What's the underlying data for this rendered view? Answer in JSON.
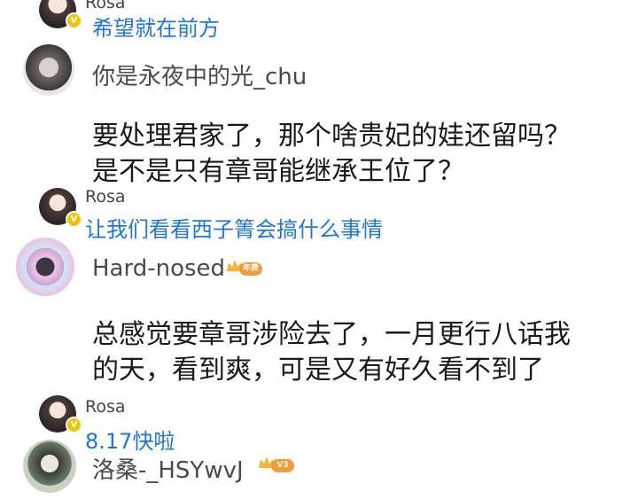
{
  "threads": [
    {
      "reply": {
        "name": "Rosa",
        "text": "希望就在前方"
      }
    },
    {
      "user": {
        "name": "你是永夜中的光_chu"
      },
      "comment": {
        "lines": [
          "要处理君家了，那个啥贵妃的娃还留吗？",
          "是不是只有章哥能继承王位了？"
        ]
      },
      "reply": {
        "name": "Rosa",
        "text": "让我们看看西子箐会搞什么事情"
      }
    },
    {
      "user": {
        "name": "Hard-nosed",
        "badge": "年费"
      },
      "comment": {
        "lines": [
          "总感觉要章哥涉险去了，一月更行八话我",
          "的天，看到爽，可是又有好久看不到了"
        ]
      },
      "reply": {
        "name": "Rosa",
        "text": "8.17快啦"
      }
    },
    {
      "user": {
        "name": "洛桑-_HSYwvJ",
        "badge": "V3"
      }
    }
  ],
  "verified_mark": "V",
  "colors": {
    "reply_link": "#1f76d6",
    "verified": "#f2c200",
    "badge_orange": "#f39a3a"
  },
  "icons": {
    "verified": "verified-badge-icon",
    "crown": "crown-icon"
  }
}
